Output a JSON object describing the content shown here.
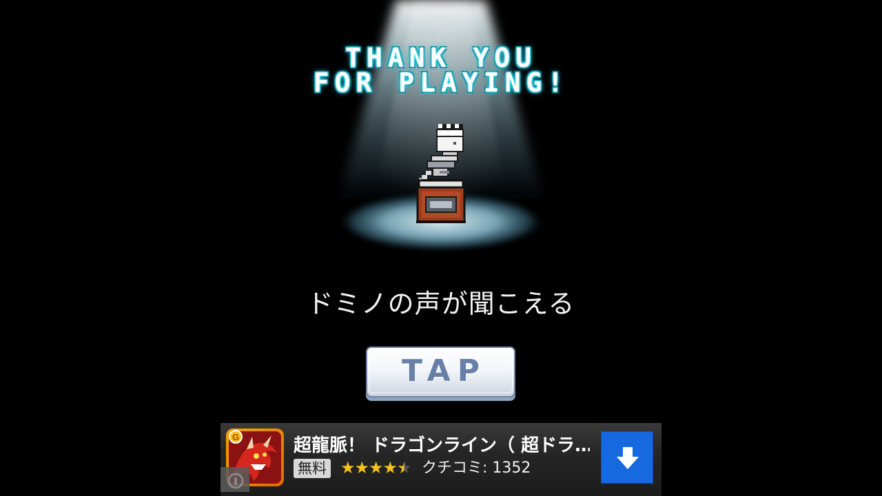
{
  "screen": {
    "title_line_1": "THANK YOU",
    "title_line_2": "FOR PLAYING!",
    "subtitle": "ドミノの声が聞こえる",
    "trophy_icon": "pixel-trophy-icon",
    "tap_button_label": "TAP"
  },
  "ad": {
    "app_icon": "dragon-app-icon",
    "title": "超龍脈！ ドラゴンライン（ 超ドラ…",
    "price_badge": "無料",
    "rating": 4.5,
    "rating_max": 5,
    "star_icon": "star-icon",
    "reviews_text": "クチコミ: 1352",
    "download_icon": "download-arrow-icon",
    "download_button_color": "#1769e0",
    "info_icon": "ad-info-icon"
  },
  "colors": {
    "background": "#000000",
    "title_glow": "#35e0f0",
    "tap_text": "#6880a8",
    "star": "#f7c21a"
  }
}
